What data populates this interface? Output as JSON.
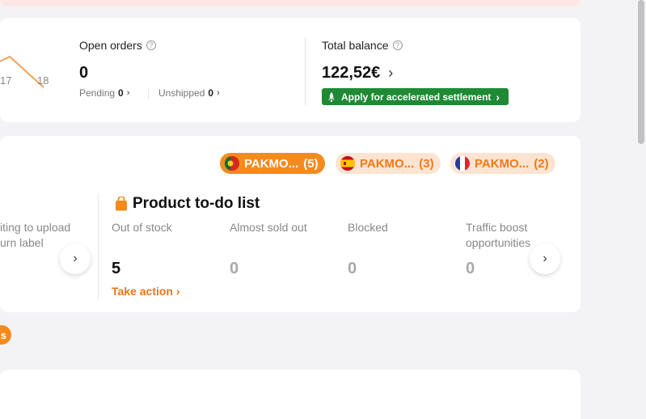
{
  "chart": {
    "ticks": [
      "17",
      "18"
    ]
  },
  "open_orders": {
    "label": "Open orders",
    "value": "0",
    "pending_label": "Pending",
    "pending_value": "0",
    "unshipped_label": "Unshipped",
    "unshipped_value": "0"
  },
  "balance": {
    "label": "Total balance",
    "value": "122,52€",
    "settle_label": "Apply for accelerated settlement"
  },
  "stores": [
    {
      "name": "PAKMO...",
      "count": "(5)",
      "flag": "portugal-flag-icon",
      "active": true
    },
    {
      "name": "PAKMO...",
      "count": "(3)",
      "flag": "spain-flag-icon",
      "active": false
    },
    {
      "name": "PAKMO...",
      "count": "(2)",
      "flag": "france-flag-icon",
      "active": false
    }
  ],
  "left_clip_text": [
    "iting to upload",
    "urn label"
  ],
  "todo": {
    "title": "Product to-do list",
    "columns": [
      {
        "label": "Out of stock",
        "value": "5"
      },
      {
        "label": "Almost sold out",
        "value": "0"
      },
      {
        "label": "Blocked",
        "value": "0"
      },
      {
        "label": "Traffic boost\nopportunities",
        "value": "0"
      }
    ],
    "take_action": "Take action"
  },
  "pill_text": "s",
  "colors": {
    "accent": "#f48b1f",
    "settle_green": "#1e8a33",
    "link_orange": "#e9761b"
  }
}
